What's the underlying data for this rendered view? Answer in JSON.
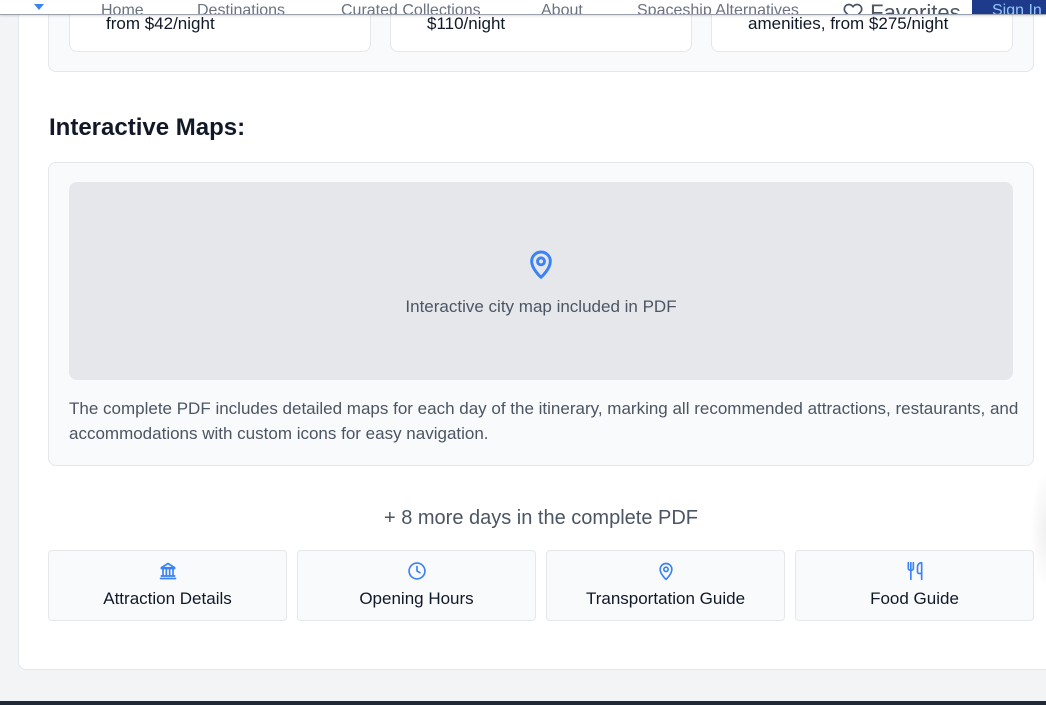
{
  "nav": {
    "items": [
      "Home",
      "Destinations",
      "Curated Collections",
      "About",
      "Spaceship Alternatives"
    ],
    "favorites_label": "Favorites",
    "signin_label": "Sign In"
  },
  "accommodations": {
    "cards": [
      {
        "text": "from $42/night"
      },
      {
        "text": "$110/night"
      },
      {
        "text": "amenities, from $275/night"
      }
    ]
  },
  "maps": {
    "title": "Interactive Maps:",
    "placeholder_text": "Interactive city map included in PDF",
    "description": "The complete PDF includes detailed maps for each day of the itinerary, marking all recommended attractions, restaurants, and accommodations with custom icons for easy navigation.",
    "pin_icon": "map-pin-icon",
    "accent_color": "#3b82f6"
  },
  "more": {
    "text": "+ 8 more days in the complete PDF"
  },
  "features": [
    {
      "label": "Attraction Details",
      "icon": "landmark-icon"
    },
    {
      "label": "Opening Hours",
      "icon": "clock-icon"
    },
    {
      "label": "Transportation Guide",
      "icon": "map-pin-icon"
    },
    {
      "label": "Food Guide",
      "icon": "utensils-icon"
    }
  ]
}
